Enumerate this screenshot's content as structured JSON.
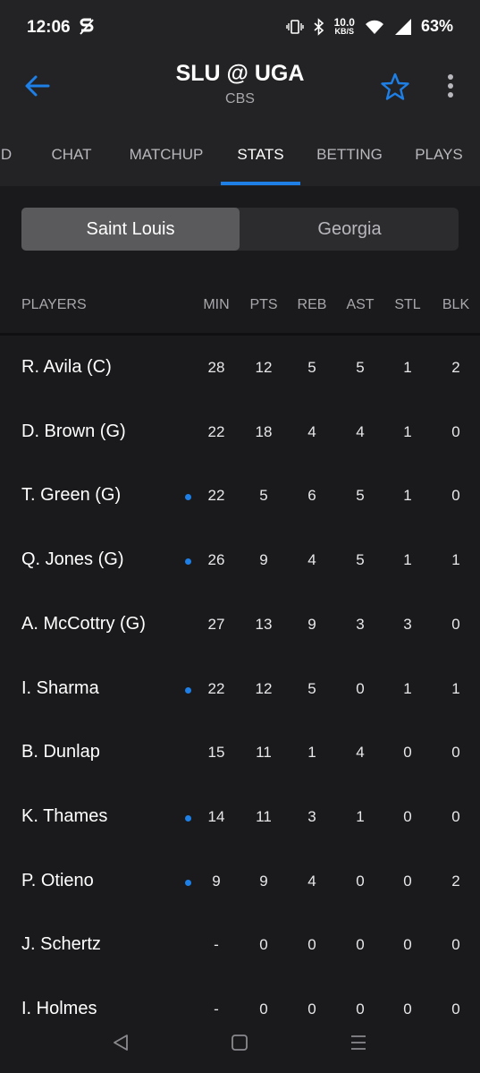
{
  "status_bar": {
    "time": "12:06",
    "speed_value": "10.0",
    "speed_unit": "KB/S",
    "battery": "63%",
    "icons": [
      "app-s-icon",
      "vibrate-icon",
      "bluetooth-icon",
      "wifi-icon",
      "signal-icon"
    ]
  },
  "app_bar": {
    "title": "SLU @ UGA",
    "network": "CBS",
    "icons": [
      "back-arrow-icon",
      "star-icon",
      "more-vert-icon"
    ],
    "accent_color": "#1e7fe6"
  },
  "tabs": [
    {
      "label": "D"
    },
    {
      "label": "CHAT"
    },
    {
      "label": "MATCHUP"
    },
    {
      "label": "STATS",
      "active": true
    },
    {
      "label": "BETTING"
    },
    {
      "label": "PLAYS"
    }
  ],
  "team_toggle": {
    "selected": "Saint Louis",
    "other": "Georgia"
  },
  "table": {
    "headers": {
      "player": "PLAYERS",
      "min": "MIN",
      "pts": "PTS",
      "reb": "REB",
      "ast": "AST",
      "stl": "STL",
      "blk": "BLK"
    },
    "rows": [
      {
        "name": "R. Avila (C)",
        "on_court": false,
        "min": "28",
        "pts": "12",
        "reb": "5",
        "ast": "5",
        "stl": "1",
        "blk": "2"
      },
      {
        "name": "D. Brown (G)",
        "on_court": false,
        "min": "22",
        "pts": "18",
        "reb": "4",
        "ast": "4",
        "stl": "1",
        "blk": "0"
      },
      {
        "name": "T. Green (G)",
        "on_court": true,
        "min": "22",
        "pts": "5",
        "reb": "6",
        "ast": "5",
        "stl": "1",
        "blk": "0"
      },
      {
        "name": "Q. Jones (G)",
        "on_court": true,
        "min": "26",
        "pts": "9",
        "reb": "4",
        "ast": "5",
        "stl": "1",
        "blk": "1"
      },
      {
        "name": "A. McCottry (G)",
        "on_court": false,
        "min": "27",
        "pts": "13",
        "reb": "9",
        "ast": "3",
        "stl": "3",
        "blk": "0"
      },
      {
        "name": "I. Sharma",
        "on_court": true,
        "min": "22",
        "pts": "12",
        "reb": "5",
        "ast": "0",
        "stl": "1",
        "blk": "1"
      },
      {
        "name": "B. Dunlap",
        "on_court": false,
        "min": "15",
        "pts": "11",
        "reb": "1",
        "ast": "4",
        "stl": "0",
        "blk": "0"
      },
      {
        "name": "K. Thames",
        "on_court": true,
        "min": "14",
        "pts": "11",
        "reb": "3",
        "ast": "1",
        "stl": "0",
        "blk": "0"
      },
      {
        "name": "P. Otieno",
        "on_court": true,
        "min": "9",
        "pts": "9",
        "reb": "4",
        "ast": "0",
        "stl": "0",
        "blk": "2"
      },
      {
        "name": "J. Schertz",
        "on_court": false,
        "min": "-",
        "pts": "0",
        "reb": "0",
        "ast": "0",
        "stl": "0",
        "blk": "0"
      },
      {
        "name": "I. Holmes",
        "on_court": false,
        "min": "-",
        "pts": "0",
        "reb": "0",
        "ast": "0",
        "stl": "0",
        "blk": "0"
      }
    ]
  },
  "nav_bar": {
    "icons": [
      "back-triangle-icon",
      "home-square-icon",
      "recents-lines-icon"
    ]
  }
}
